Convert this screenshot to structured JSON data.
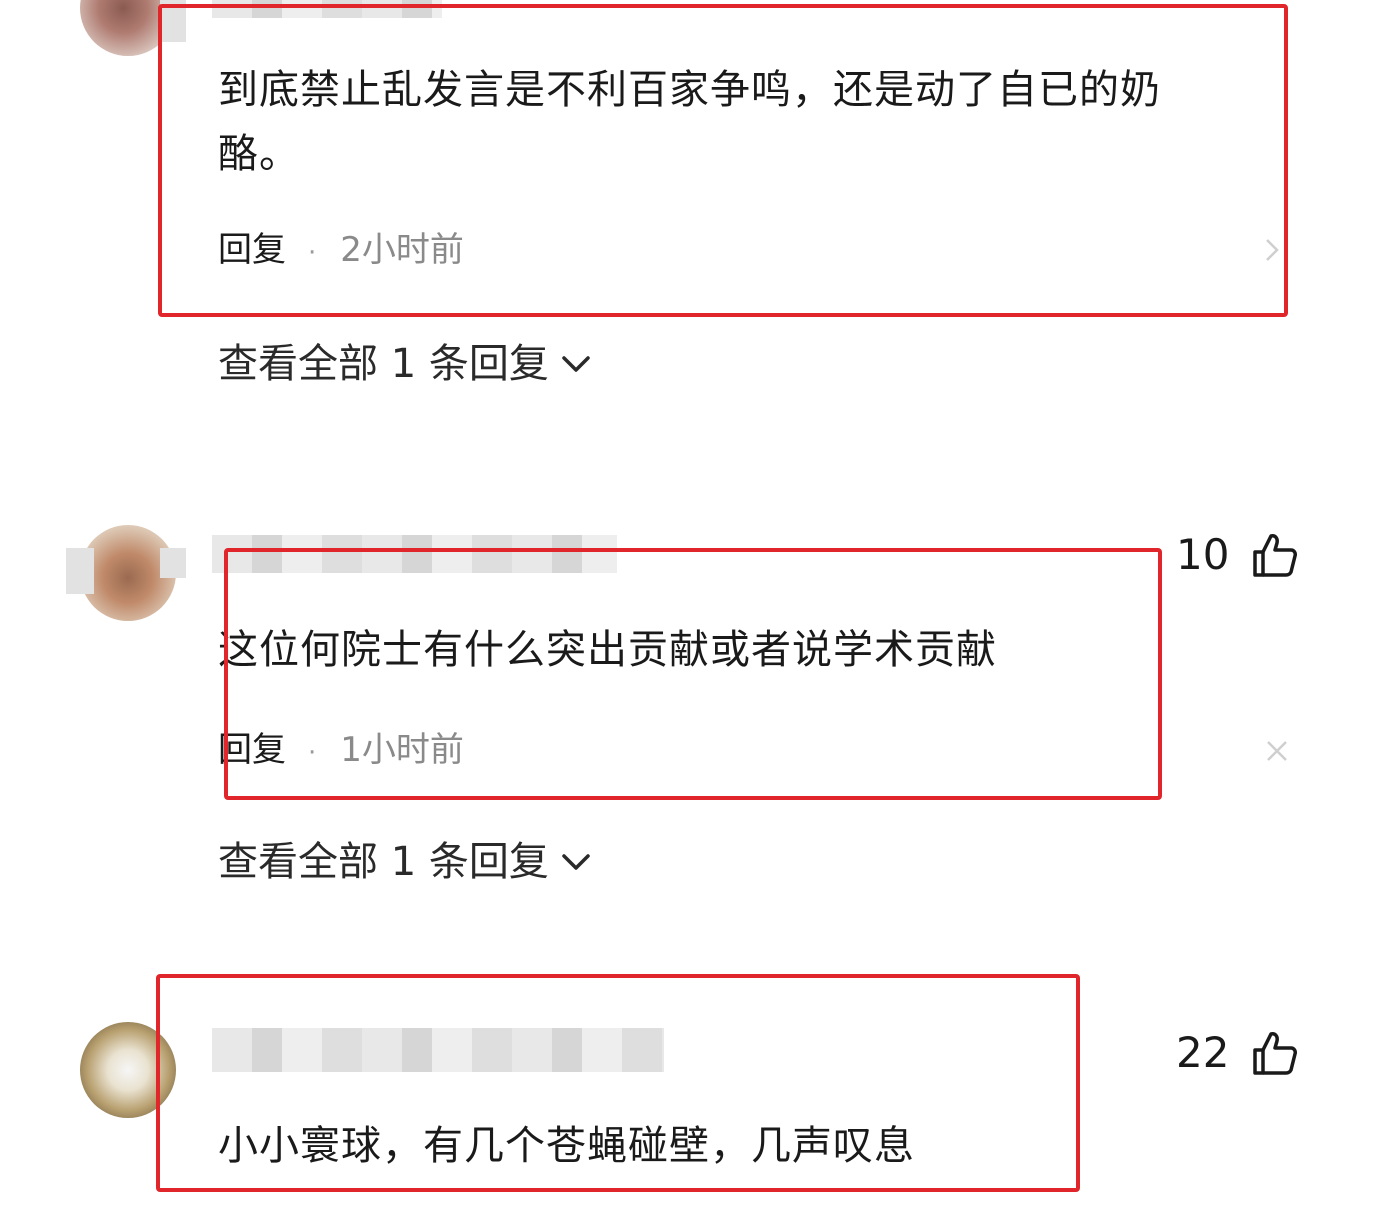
{
  "comments": [
    {
      "text_line1": "到底禁止乱发言是不利百家争鸣，还是动了自已的奶",
      "text_line2": "酪。",
      "reply_label": "回复",
      "time": "2小时前",
      "view_all": "查看全部 1 条回复"
    },
    {
      "likes": "10",
      "text_line1": "这位何院士有什么突出贡献或者说学术贡献",
      "reply_label": "回复",
      "time": "1小时前",
      "view_all": "查看全部 1 条回复"
    },
    {
      "likes": "22",
      "text_line1": "小小寰球，有几个苍蝇碰壁，几声叹息"
    }
  ],
  "icons": {
    "like": "thumbs-up-icon",
    "expand": "chevron-down-icon",
    "more": "chevron-right-icon",
    "close": "close-icon"
  },
  "colors": {
    "highlight_box": "#e0262b",
    "time_text": "#8a8a8a"
  }
}
